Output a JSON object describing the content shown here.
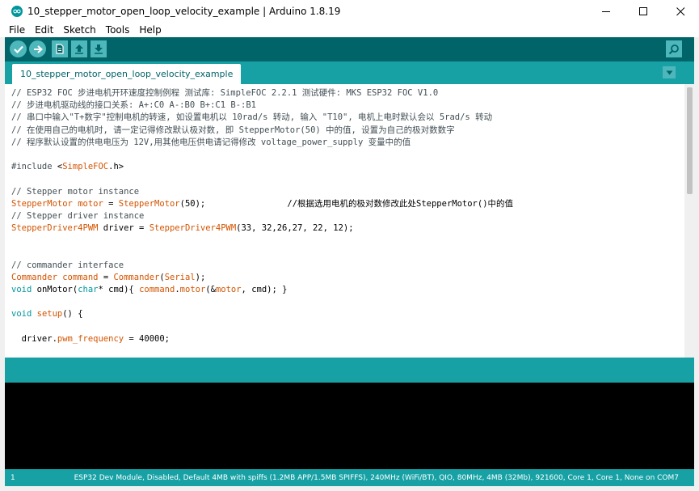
{
  "window": {
    "title": "10_stepper_motor_open_loop_velocity_example | Arduino 1.8.19"
  },
  "menu": [
    "File",
    "Edit",
    "Sketch",
    "Tools",
    "Help"
  ],
  "toolbar": {
    "verify": "check-icon",
    "upload": "arrow-right-icon",
    "new": "new-file-icon",
    "open": "open-arrow-up-icon",
    "save": "save-arrow-down-icon",
    "serial_monitor": "magnifier-icon"
  },
  "tab": {
    "label": "10_stepper_motor_open_loop_velocity_example"
  },
  "code": {
    "lines": [
      [
        {
          "t": "// ESP32 FOC 步进电机开环速度控制例程 测试库: SimpleFOC 2.2.1 测试硬件: MKS ESP32 FOC V1.0",
          "c": "comment"
        }
      ],
      [
        {
          "t": "// 步进电机驱动线的接口关系: A+:C0 A-:B0 B+:C1 B-:B1",
          "c": "comment"
        }
      ],
      [
        {
          "t": "// 串口中输入\"T+数字\"控制电机的转速, 如设置电机以 10rad/s 转动, 输入 \"T10\", 电机上电时默认会以 5rad/s 转动",
          "c": "comment"
        }
      ],
      [
        {
          "t": "// 在使用自己的电机时, 请一定记得修改默认极对数, 即 StepperMotor(50) 中的值, 设置为自己的极对数数字",
          "c": "comment"
        }
      ],
      [
        {
          "t": "// 程序默认设置的供电电压为 12V,用其他电压供电请记得修改 voltage_power_supply 变量中的值",
          "c": "comment"
        }
      ],
      [
        {
          "t": "",
          "c": "plain"
        }
      ],
      [
        {
          "t": "#include ",
          "c": "comment"
        },
        {
          "t": "<",
          "c": "plain"
        },
        {
          "t": "SimpleFOC",
          "c": "lib"
        },
        {
          "t": ".h>",
          "c": "plain"
        }
      ],
      [
        {
          "t": "",
          "c": "plain"
        }
      ],
      [
        {
          "t": "// Stepper motor instance",
          "c": "comment"
        }
      ],
      [
        {
          "t": "StepperMotor",
          "c": "type"
        },
        {
          "t": " ",
          "c": "plain"
        },
        {
          "t": "motor",
          "c": "type"
        },
        {
          "t": " = ",
          "c": "plain"
        },
        {
          "t": "StepperMotor",
          "c": "type"
        },
        {
          "t": "(50);                //根据选用电机的极对数修改此处StepperMotor()中的值",
          "c": "plain"
        }
      ],
      [
        {
          "t": "// Stepper driver instance",
          "c": "comment"
        }
      ],
      [
        {
          "t": "StepperDriver4PWM",
          "c": "type"
        },
        {
          "t": " driver = ",
          "c": "plain"
        },
        {
          "t": "StepperDriver4PWM",
          "c": "type"
        },
        {
          "t": "(33, 32,26,27, 22, 12);",
          "c": "plain"
        }
      ],
      [
        {
          "t": "",
          "c": "plain"
        }
      ],
      [
        {
          "t": "",
          "c": "plain"
        }
      ],
      [
        {
          "t": "// commander interface",
          "c": "comment"
        }
      ],
      [
        {
          "t": "Commander",
          "c": "type"
        },
        {
          "t": " ",
          "c": "plain"
        },
        {
          "t": "command",
          "c": "type"
        },
        {
          "t": " = ",
          "c": "plain"
        },
        {
          "t": "Commander",
          "c": "type"
        },
        {
          "t": "(",
          "c": "plain"
        },
        {
          "t": "Serial",
          "c": "type"
        },
        {
          "t": ");",
          "c": "plain"
        }
      ],
      [
        {
          "t": "void",
          "c": "kw"
        },
        {
          "t": " onMotor(",
          "c": "plain"
        },
        {
          "t": "char",
          "c": "kw"
        },
        {
          "t": "* cmd){ ",
          "c": "plain"
        },
        {
          "t": "command",
          "c": "type"
        },
        {
          "t": ".",
          "c": "plain"
        },
        {
          "t": "motor",
          "c": "type"
        },
        {
          "t": "(&",
          "c": "plain"
        },
        {
          "t": "motor",
          "c": "type"
        },
        {
          "t": ", cmd); }",
          "c": "plain"
        }
      ],
      [
        {
          "t": "",
          "c": "plain"
        }
      ],
      [
        {
          "t": "void",
          "c": "kw"
        },
        {
          "t": " ",
          "c": "plain"
        },
        {
          "t": "setup",
          "c": "type"
        },
        {
          "t": "() {",
          "c": "plain"
        }
      ],
      [
        {
          "t": "",
          "c": "plain"
        }
      ],
      [
        {
          "t": "  driver.",
          "c": "plain"
        },
        {
          "t": "pwm_frequency",
          "c": "type"
        },
        {
          "t": " = 40000;",
          "c": "plain"
        }
      ]
    ]
  },
  "status": {
    "line_number": "1",
    "board": "ESP32 Dev Module, Disabled, Default 4MB with spiffs (1.2MB APP/1.5MB SPIFFS), 240MHz (WiFi/BT), QIO, 80MHz, 4MB (32Mb), 921600, Core 1, Core 1, None on COM7"
  },
  "colors": {
    "toolbar": "#006468",
    "tabbar": "#17a1a5",
    "button": "#4db7bb",
    "comment": "#434f54",
    "keyword": "#00979c",
    "type": "#d35400",
    "console": "#000000"
  }
}
